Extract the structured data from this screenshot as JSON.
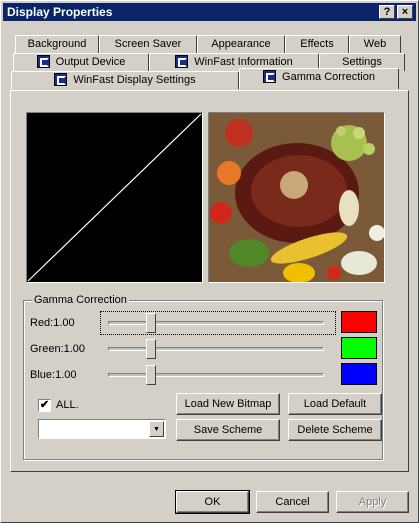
{
  "window": {
    "title": "Display Properties",
    "help_label": "?",
    "close_label": "×"
  },
  "tabs": {
    "row1": [
      "Background",
      "Screen Saver",
      "Appearance",
      "Effects",
      "Web"
    ],
    "row2": [
      "Output Device",
      "WinFast Information",
      "Settings"
    ],
    "row3": [
      "WinFast Display Settings",
      "Gamma Correction"
    ],
    "active": "Gamma Correction"
  },
  "gamma": {
    "group_label": "Gamma Correction",
    "red_label": "Red:1.00",
    "green_label": "Green:1.00",
    "blue_label": "Blue:1.00",
    "red_value": 1.0,
    "green_value": 1.0,
    "blue_value": 1.0,
    "red_color": "#ff0000",
    "green_color": "#00ff00",
    "blue_color": "#0000ff",
    "all_label": "ALL.",
    "all_checked": true,
    "scheme_value": ""
  },
  "buttons": {
    "load_bitmap": "Load New Bitmap",
    "load_default": "Load Default",
    "save_scheme": "Save Scheme",
    "delete_scheme": "Delete Scheme",
    "ok": "OK",
    "cancel": "Cancel",
    "apply": "Apply"
  },
  "icons": {
    "checkmark": "✔",
    "dropdown": "▼",
    "tab_logo": "winfast-logo-icon"
  }
}
